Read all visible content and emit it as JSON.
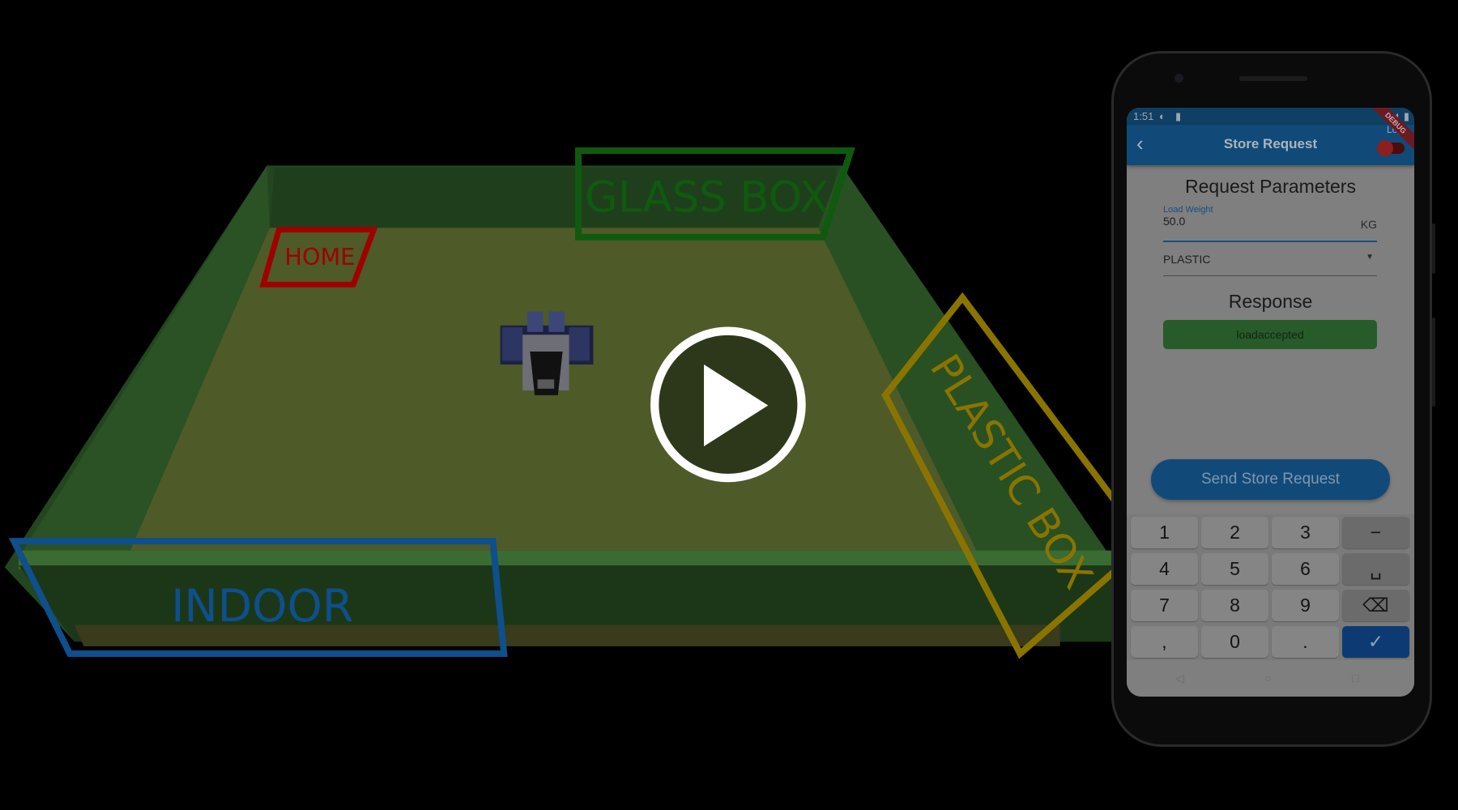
{
  "scene": {
    "zones": {
      "home": "HOME",
      "glass_box": "GLASS BOX",
      "plastic_box": "PLASTIC BOX",
      "indoor": "INDOOR"
    },
    "play_icon": "play-icon",
    "colors": {
      "home": "#a00000",
      "glass_box": "#0f5a0f",
      "plastic_box": "#8a7400",
      "indoor": "#0e4f8c"
    }
  },
  "phone": {
    "status": {
      "time": "1:51"
    },
    "appbar": {
      "title": "Store Request",
      "log_label": "Log",
      "debug_banner": "DEBUG",
      "log_toggle_on": false
    },
    "request_title": "Request Parameters",
    "load_weight": {
      "label": "Load Weight",
      "value": "50.0",
      "unit": "KG"
    },
    "material": {
      "selected": "PLASTIC"
    },
    "response_title": "Response",
    "response_value": "loadaccepted",
    "send_button": "Send Store Request",
    "keyboard": {
      "keys": [
        "1",
        "2",
        "3",
        "−",
        "4",
        "5",
        "6",
        "␣",
        "7",
        "8",
        "9",
        "⌫",
        ",",
        "0",
        ".",
        "✓"
      ]
    },
    "navbar": {
      "back": "◁",
      "home": "○",
      "recents": "□"
    }
  }
}
